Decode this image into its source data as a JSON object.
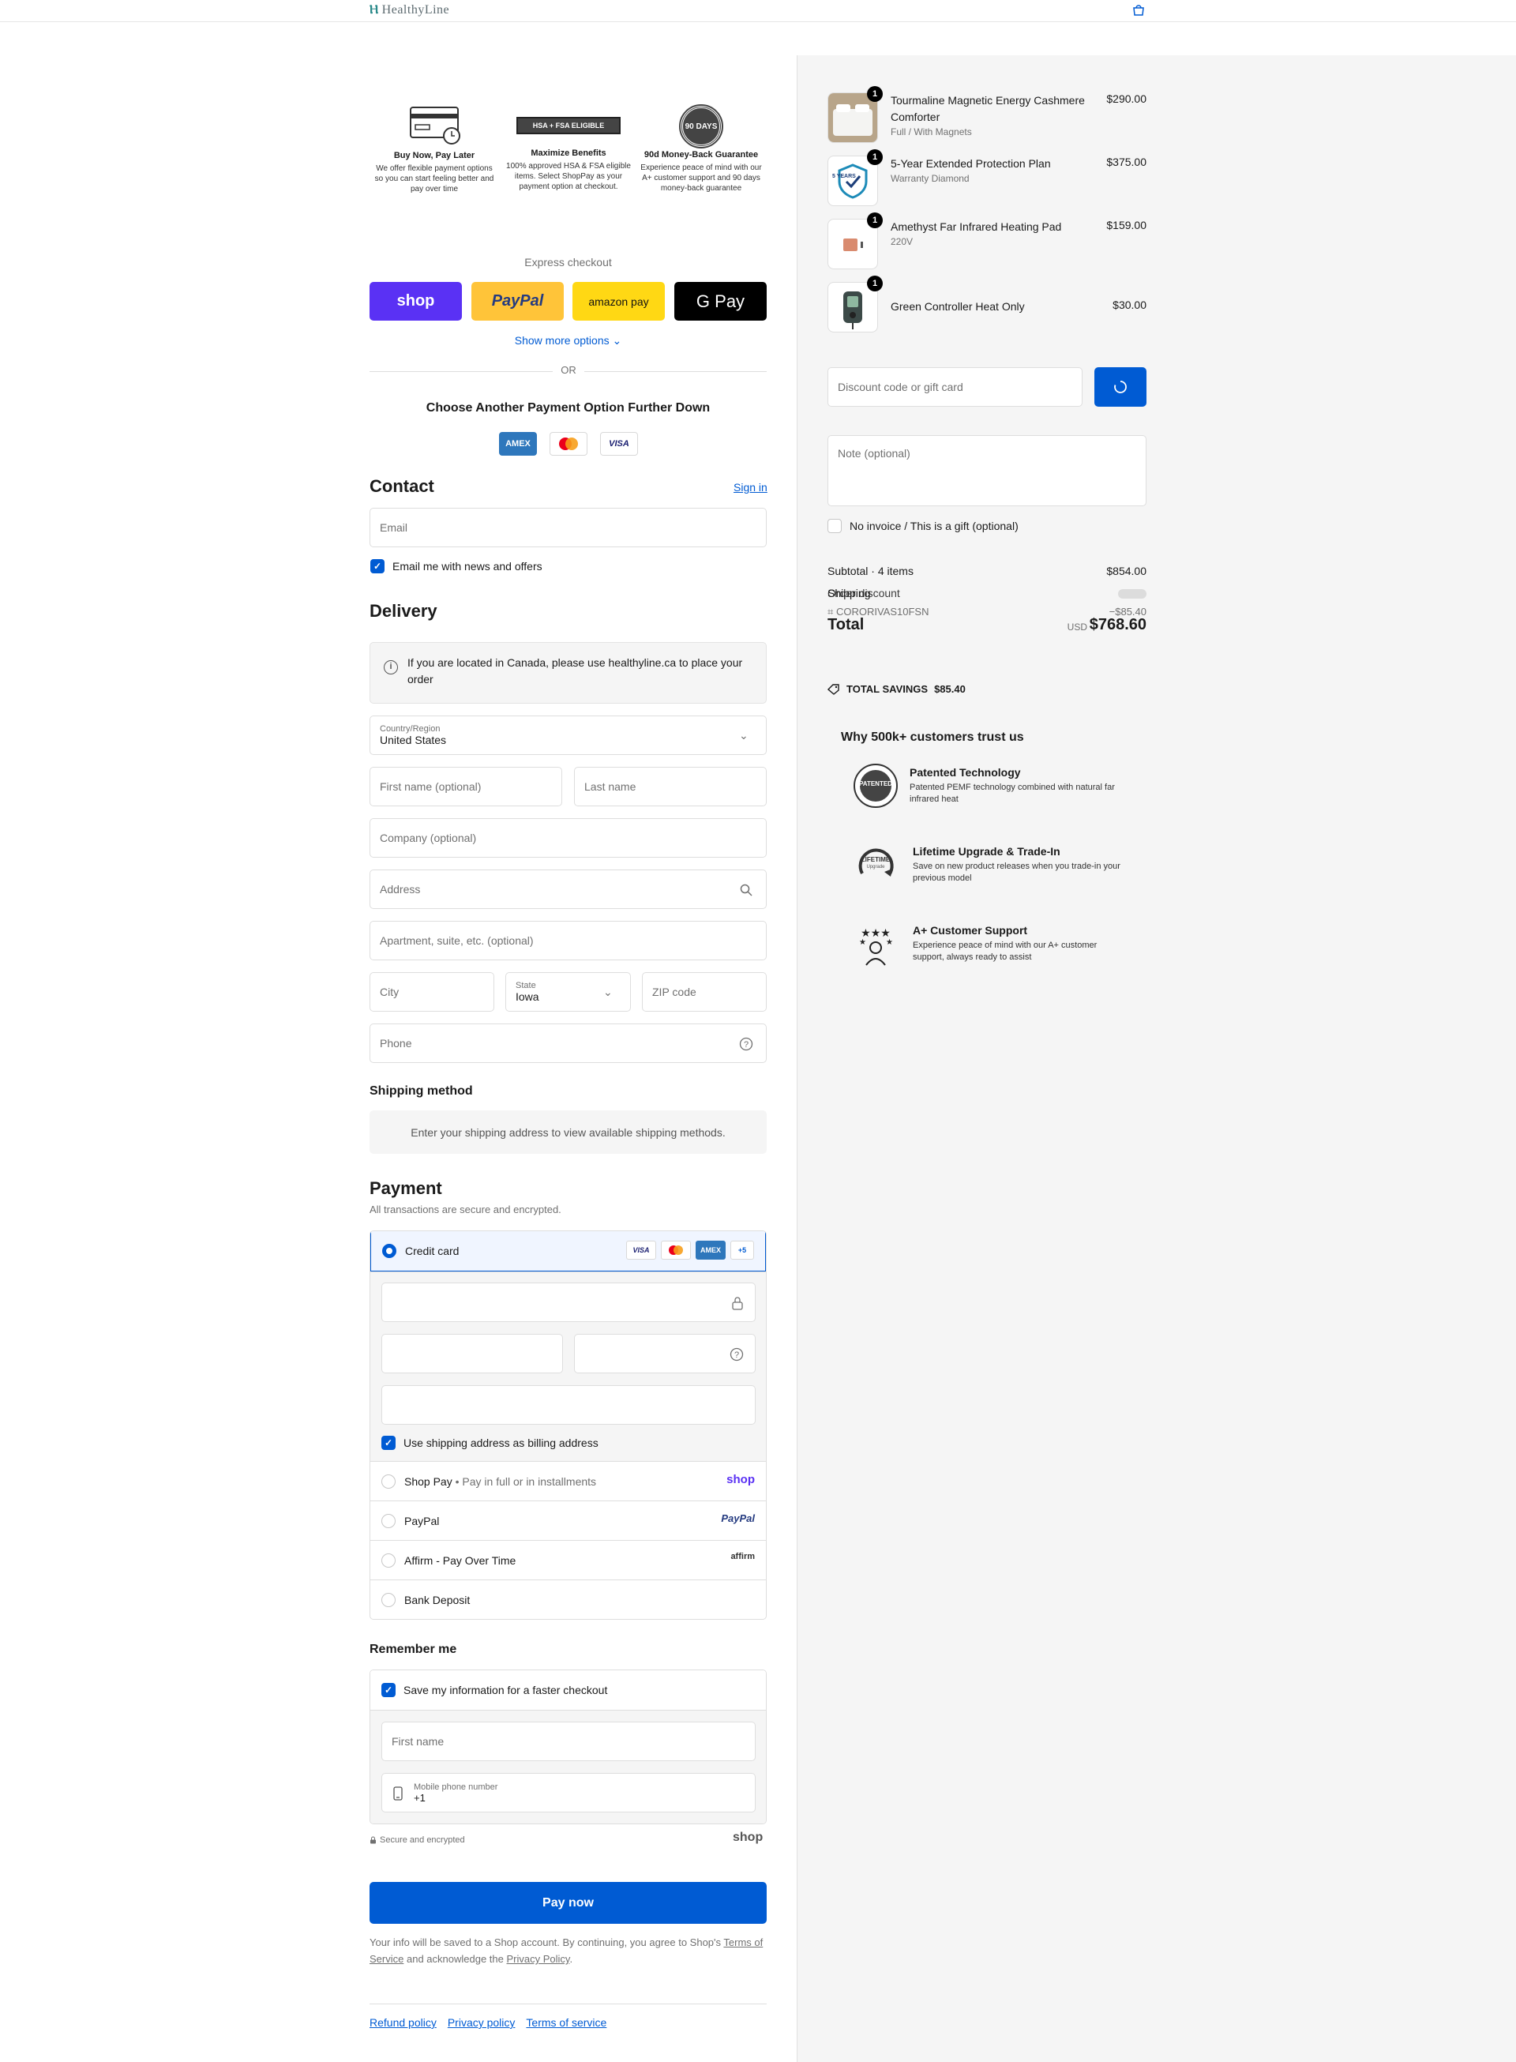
{
  "header": {
    "brand": "HealthyLine",
    "cart_icon": "shopping-bag-icon"
  },
  "benefits": [
    {
      "title": "Buy Now, Pay Later",
      "text": "We offer flexible payment options so you can start feeling better and pay over time",
      "icon": "credit-card-icon"
    },
    {
      "title": "Maximize Benefits",
      "text": "100% approved HSA & FSA eligible items. Select ShopPay as your payment option at checkout.",
      "icon": "hsa-fsa-badge",
      "badge_text": "HSA + FSA ELIGIBLE"
    },
    {
      "title": "90d Money-Back Guarantee",
      "text": "Experience peace of mind with our A+ customer support and 90 days money-back guarantee",
      "icon": "guarantee-seal",
      "badge_text": "90 DAYS"
    }
  ],
  "express": {
    "label": "Express checkout",
    "buttons": [
      {
        "label": "shop",
        "color": "#5a31f4"
      },
      {
        "label": "PayPal",
        "color": "#ffc439"
      },
      {
        "label": "amazon pay",
        "color": "#ffd814"
      },
      {
        "label": "G Pay",
        "color": "#000000"
      }
    ],
    "show_more": "Show more options",
    "or": "OR",
    "choose_text": "Choose Another Payment Option Further Down",
    "card_logos": [
      "AMEX",
      "mastercard",
      "VISA"
    ]
  },
  "contact": {
    "heading": "Contact",
    "sign_in": "Sign in",
    "email_placeholder": "Email",
    "newsletter_label": "Email me with news and offers",
    "newsletter_checked": true
  },
  "delivery": {
    "heading": "Delivery",
    "notice": "If you are located in Canada, please use healthyline.ca to place your order",
    "country_label": "Country/Region",
    "country_value": "United States",
    "first_name": "First name (optional)",
    "last_name": "Last name",
    "company": "Company (optional)",
    "address": "Address",
    "apartment": "Apartment, suite, etc. (optional)",
    "city": "City",
    "state_label": "State",
    "state_value": "Iowa",
    "zip": "ZIP code",
    "phone": "Phone"
  },
  "shipping": {
    "heading": "Shipping method",
    "message": "Enter your shipping address to view available shipping methods."
  },
  "payment": {
    "heading": "Payment",
    "subtitle": "All transactions are secure and encrypted.",
    "credit_card_label": "Credit card",
    "card_badges": [
      "VISA",
      "MC",
      "AMEX",
      "+5"
    ],
    "billing_label": "Use shipping address as billing address",
    "options": [
      {
        "label": "Shop Pay",
        "extra": "• Pay in full or in installments",
        "logo": "shop"
      },
      {
        "label": "PayPal",
        "extra": "",
        "logo": "PayPal"
      },
      {
        "label": "Affirm - Pay Over Time",
        "extra": "",
        "logo": "affirm"
      },
      {
        "label": "Bank Deposit",
        "extra": "",
        "logo": ""
      }
    ]
  },
  "remember": {
    "heading": "Remember me",
    "save_label": "Save my information for a faster checkout",
    "first_name": "First name",
    "mobile_label": "Mobile phone number",
    "mobile_value": "+1",
    "secure_text": "Secure and encrypted",
    "shop_logo": "shop"
  },
  "pay_now": "Pay now",
  "legal": {
    "part1": "Your info will be saved to a Shop account. By continuing, you agree to Shop's",
    "terms": "Terms of Service",
    "part2": "and acknowledge the",
    "privacy": "Privacy Policy",
    "part3": "."
  },
  "footer": [
    "Refund policy",
    "Privacy policy",
    "Terms of service"
  ],
  "cart": {
    "items": [
      {
        "name": "Tourmaline Magnetic Energy Cashmere Comforter",
        "variant": "Full / With Magnets",
        "price": "$290.00",
        "qty": "1"
      },
      {
        "name": "5-Year Extended Protection Plan",
        "variant": "Warranty Diamond",
        "price": "$375.00",
        "qty": "1",
        "badge_text": "5 YEARS"
      },
      {
        "name": "Amethyst Far Infrared Heating Pad",
        "variant": "220V",
        "price": "$159.00",
        "qty": "1"
      },
      {
        "name": "Green Controller Heat Only",
        "variant": "",
        "price": "$30.00",
        "qty": "1"
      }
    ],
    "discount_placeholder": "Discount code or gift card",
    "note_placeholder": "Note (optional)",
    "gift_label": "No invoice / This is a gift (optional)",
    "subtotal_label": "Subtotal · 4 items",
    "subtotal_value": "$854.00",
    "shipping_label": "Shipping",
    "discount_label": "Order discount",
    "discount_code": "CORORIVAS10FSN",
    "discount_value": "−$85.40",
    "total_label": "Total",
    "currency": "USD",
    "total_value": "$768.60",
    "savings_label": "TOTAL SAVINGS",
    "savings_value": "$85.40"
  },
  "trust": {
    "title": "Why 500k+ customers trust us",
    "items": [
      {
        "title": "Patented Technology",
        "text": "Patented PEMF technology combined with natural far infrared heat",
        "icon": "patented-seal-icon",
        "badge_text": "PATENTED"
      },
      {
        "title": "Lifetime Upgrade & Trade-In",
        "text": "Save on new product releases when you trade-in your previous model",
        "icon": "lifetime-upgrade-icon",
        "badge_text": "LIFETIME",
        "badge_subtext": "Upgrade"
      },
      {
        "title": "A+ Customer Support",
        "text": "Experience peace of mind with our A+ customer support, always ready to assist",
        "icon": "five-star-support-icon"
      }
    ]
  }
}
